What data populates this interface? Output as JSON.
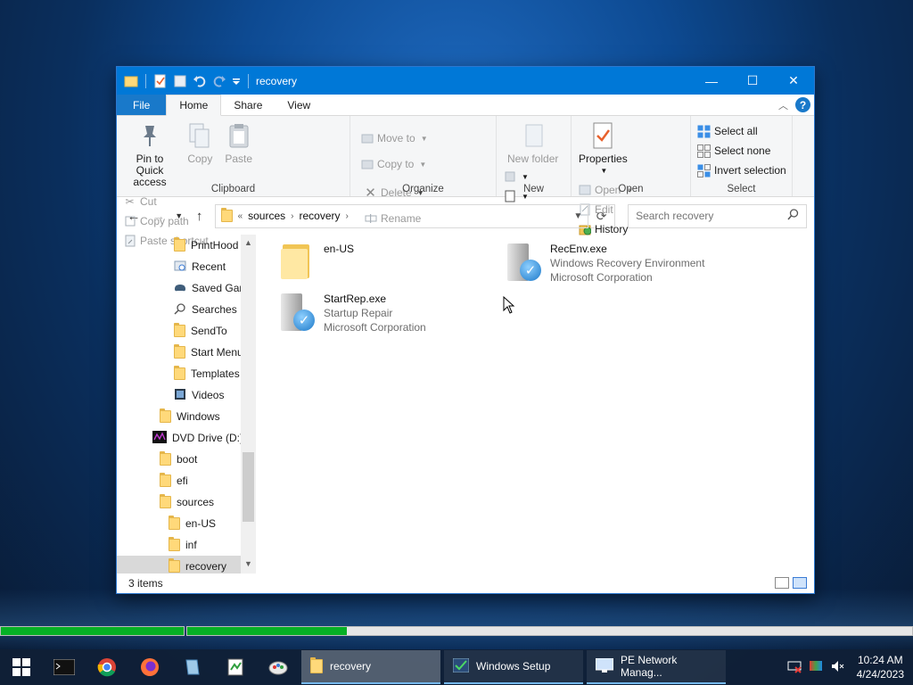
{
  "window": {
    "title": "recovery",
    "controls": {
      "minimize": "—",
      "maximize": "☐",
      "close": "✕"
    }
  },
  "ribbon_tabs": {
    "file": "File",
    "home": "Home",
    "share": "Share",
    "view": "View"
  },
  "ribbon": {
    "clipboard": {
      "label": "Clipboard",
      "pin": "Pin to Quick access",
      "copy": "Copy",
      "paste": "Paste",
      "cut": "Cut",
      "copy_path": "Copy path",
      "paste_shortcut": "Paste shortcut"
    },
    "organize": {
      "label": "Organize",
      "move_to": "Move to",
      "copy_to": "Copy to",
      "delete": "Delete",
      "rename": "Rename"
    },
    "new": {
      "label": "New",
      "new_folder": "New folder"
    },
    "open": {
      "label": "Open",
      "properties": "Properties",
      "open": "Open",
      "edit": "Edit",
      "history": "History"
    },
    "select": {
      "label": "Select",
      "select_all": "Select all",
      "select_none": "Select none",
      "invert": "Invert selection"
    }
  },
  "address": {
    "overflow": "«",
    "crumbs": [
      "sources",
      "recovery"
    ],
    "search_placeholder": "Search recovery"
  },
  "nav_pane": {
    "items": [
      {
        "label": "PrintHood",
        "icon": "folder-icon"
      },
      {
        "label": "Recent",
        "icon": "recent-icon"
      },
      {
        "label": "Saved Gan",
        "icon": "saved-games-icon"
      },
      {
        "label": "Searches",
        "icon": "search-icon"
      },
      {
        "label": "SendTo",
        "icon": "folder-icon"
      },
      {
        "label": "Start Menu",
        "icon": "folder-icon"
      },
      {
        "label": "Templates",
        "icon": "folder-icon"
      },
      {
        "label": "Videos",
        "icon": "videos-icon"
      },
      {
        "label": "Windows",
        "icon": "folder-icon"
      },
      {
        "label": "DVD Drive (D:)",
        "icon": "dvd-drive-icon"
      },
      {
        "label": "boot",
        "icon": "folder-icon"
      },
      {
        "label": "efi",
        "icon": "folder-icon"
      },
      {
        "label": "sources",
        "icon": "folder-icon"
      },
      {
        "label": "en-US",
        "icon": "folder-icon"
      },
      {
        "label": "inf",
        "icon": "folder-icon"
      },
      {
        "label": "recovery",
        "icon": "folder-icon"
      }
    ]
  },
  "files": [
    {
      "name": "en-US",
      "line2": "",
      "line3": "",
      "type": "folder"
    },
    {
      "name": "RecEnv.exe",
      "line2": "Windows Recovery Environment",
      "line3": "Microsoft Corporation",
      "type": "exe"
    },
    {
      "name": "StartRep.exe",
      "line2": "Startup Repair",
      "line3": "Microsoft Corporation",
      "type": "exe"
    }
  ],
  "status": {
    "items": "3 items"
  },
  "progress": {
    "segment1": 1.0,
    "segment2": 0.22
  },
  "taskbar": {
    "apps": [
      {
        "label": "recovery"
      },
      {
        "label": "Windows Setup"
      },
      {
        "label": "PE Network Manag..."
      }
    ],
    "clock_time": "10:24 AM",
    "clock_date": "4/24/2023"
  },
  "colors": {
    "accent": "#0078d7",
    "progress": "#06b025",
    "file_tab": "#1979ca"
  }
}
